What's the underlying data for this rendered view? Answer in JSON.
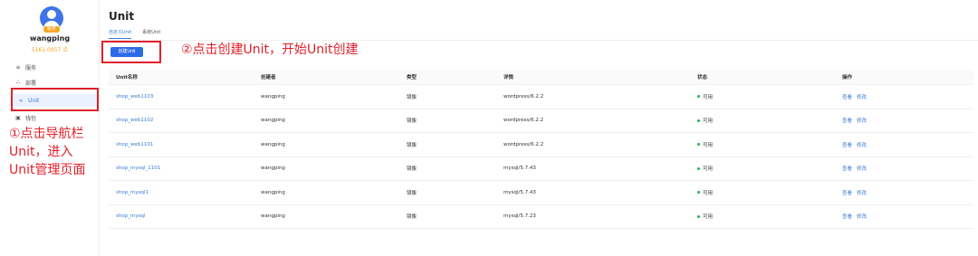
{
  "user": {
    "role_badge": "服务",
    "username": "wangping",
    "balance": "5161.0957 点"
  },
  "sidebar": {
    "items": [
      {
        "icon": "list-icon",
        "glyph": "≡",
        "label": "服务"
      },
      {
        "icon": "deploy-icon",
        "glyph": "⛬",
        "label": "部署"
      },
      {
        "icon": "share-icon",
        "glyph": "⋖",
        "label": "Unit"
      },
      {
        "icon": "wallet-icon",
        "glyph": "▣",
        "label": "钱包"
      }
    ]
  },
  "annotations": {
    "step1": [
      "①点击导航栏",
      "Unit，进入",
      "Unit管理页面"
    ],
    "step2": "②点击创建Unit，开始Unit创建"
  },
  "main": {
    "title": "Unit",
    "tabs": [
      {
        "label": "自定义Unit",
        "active": true
      },
      {
        "label": "系统Unit",
        "active": false
      }
    ],
    "create_button": "创建Unit"
  },
  "table": {
    "columns": [
      "Unit名称",
      "创建者",
      "类型",
      "详情",
      "状态",
      "操作"
    ],
    "rows": [
      {
        "name": "shop_web1103",
        "creator": "wangping",
        "type": "镜像",
        "detail": "wordpress/6.2.2",
        "status": "可用",
        "actions": [
          "查看",
          "修改"
        ]
      },
      {
        "name": "shop_web1102",
        "creator": "wangping",
        "type": "镜像",
        "detail": "wordpress/6.2.2",
        "status": "可用",
        "actions": [
          "查看",
          "修改"
        ]
      },
      {
        "name": "shop_web1101",
        "creator": "wangping",
        "type": "镜像",
        "detail": "wordpress/6.2.2",
        "status": "可用",
        "actions": [
          "查看",
          "修改"
        ]
      },
      {
        "name": "shop_mysql_1101",
        "creator": "wangping",
        "type": "镜像",
        "detail": "mysql/5.7.43",
        "status": "可用",
        "actions": [
          "查看",
          "修改"
        ]
      },
      {
        "name": "shop_mysql1",
        "creator": "wangping",
        "type": "镜像",
        "detail": "mysql/5.7.43",
        "status": "可用",
        "actions": [
          "查看",
          "修改"
        ]
      },
      {
        "name": "shop_mysql",
        "creator": "wangping",
        "type": "镜像",
        "detail": "mysql/5.7.23",
        "status": "可用",
        "actions": [
          "查看",
          "修改"
        ]
      }
    ]
  },
  "colors": {
    "accent": "#2d6be6",
    "annotation": "#e0202a",
    "status_ok": "#22b14c",
    "balance": "#f5a623"
  }
}
